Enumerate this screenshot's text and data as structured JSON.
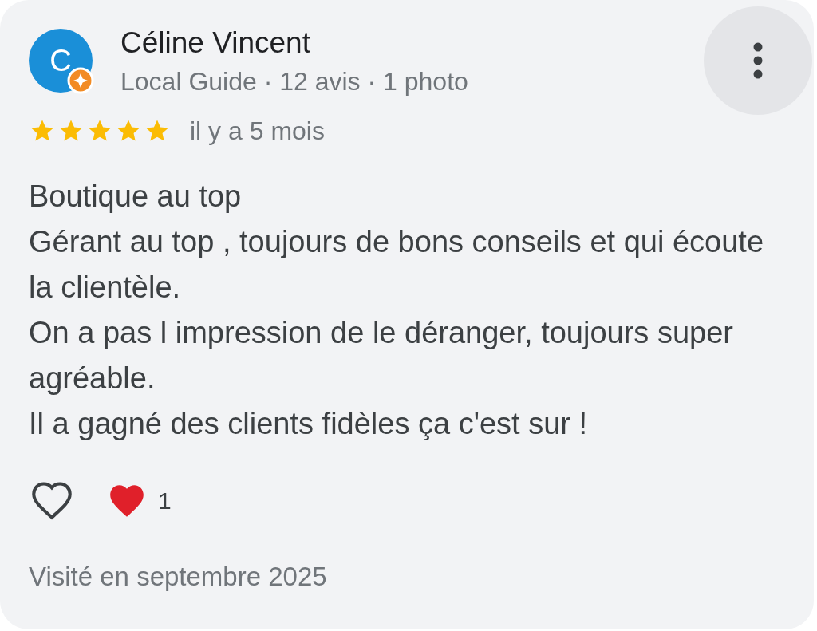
{
  "review": {
    "avatar_letter": "C",
    "local_guide": true,
    "name": "Céline Vincent",
    "meta": "Local Guide · 12 avis · 1 photo",
    "stars": 5,
    "time": "il y a 5 mois",
    "paragraphs": [
      "Boutique au top",
      "Gérant au top , toujours de bons conseils et qui écoute la clientèle.",
      "On a pas l impression de le déranger, toujours super agréable.",
      "Il a gagné des clients fidèles ça c'est sur !"
    ],
    "liked": false,
    "reaction_count": "1",
    "visited": "Visité en septembre 2025"
  }
}
